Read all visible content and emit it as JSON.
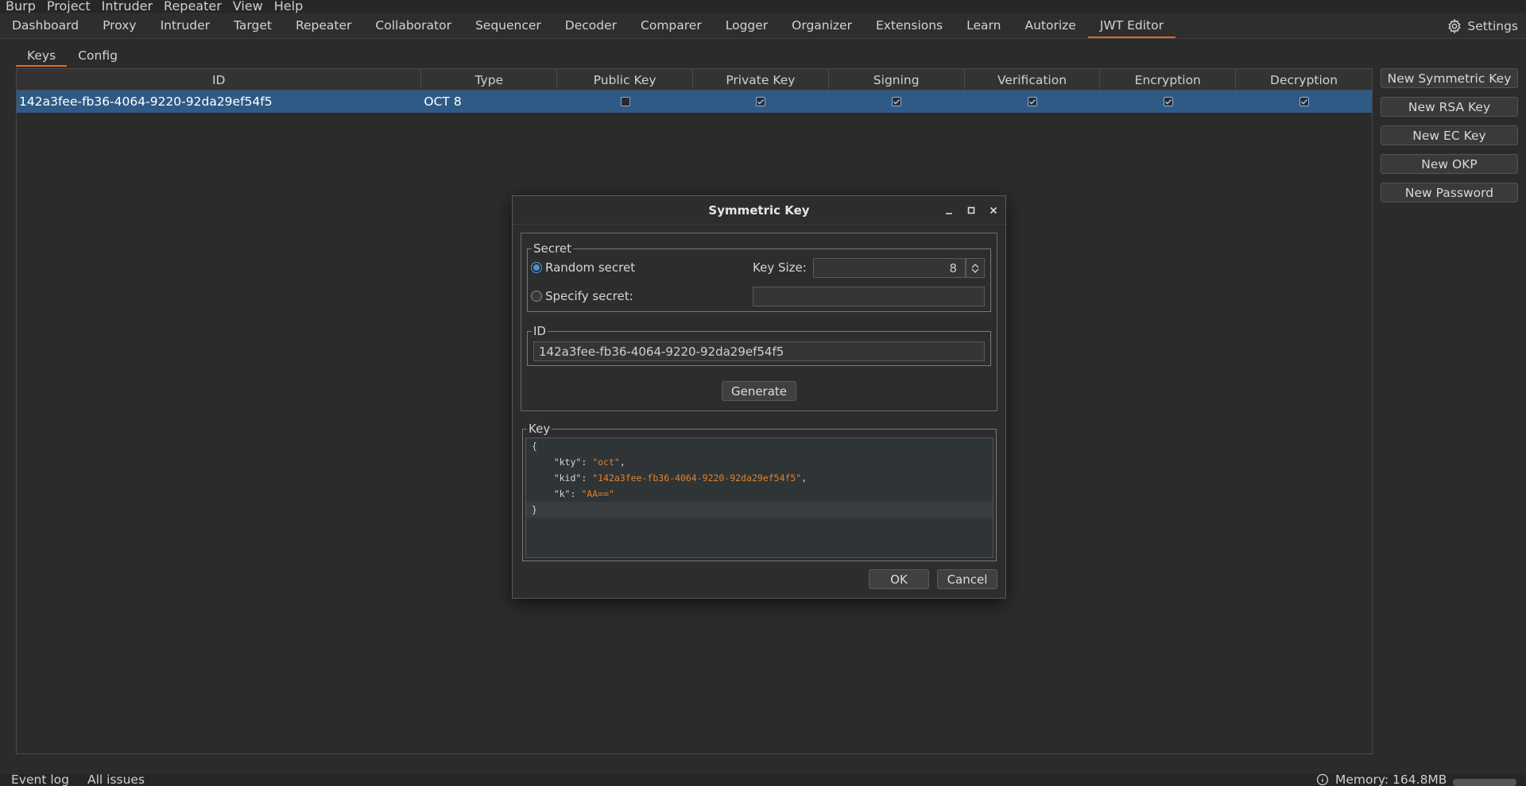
{
  "menubar": [
    "Burp",
    "Project",
    "Intruder",
    "Repeater",
    "View",
    "Help"
  ],
  "tabs": [
    "Dashboard",
    "Proxy",
    "Intruder",
    "Target",
    "Repeater",
    "Collaborator",
    "Sequencer",
    "Decoder",
    "Comparer",
    "Logger",
    "Organizer",
    "Extensions",
    "Learn",
    "Autorize",
    "JWT Editor"
  ],
  "active_tab": "JWT Editor",
  "settings_label": "Settings",
  "subtabs": [
    "Keys",
    "Config"
  ],
  "table": {
    "columns": [
      "ID",
      "Type",
      "Public Key",
      "Private Key",
      "Signing",
      "Verification",
      "Encryption",
      "Decryption"
    ],
    "rows": [
      {
        "id": "142a3fee-fb36-4064-9220-92da29ef54f5",
        "type": "OCT 8",
        "public_key": false,
        "private_key": true,
        "signing": true,
        "verification": true,
        "encryption": true,
        "decryption": true
      }
    ]
  },
  "side_buttons": [
    "New Symmetric Key",
    "New RSA Key",
    "New EC Key",
    "New OKP",
    "New Password"
  ],
  "dialog": {
    "title": "Symmetric Key",
    "secret_legend": "Secret",
    "random_secret_label": "Random secret",
    "specify_secret_label": "Specify secret:",
    "random_selected": true,
    "key_size_label": "Key Size:",
    "key_size_value": "8",
    "specify_secret_value": "",
    "id_legend": "ID",
    "id_value": "142a3fee-fb36-4064-9220-92da29ef54f5",
    "generate_label": "Generate",
    "key_legend": "Key",
    "key_json": {
      "open": "{",
      "kty_key": "\"kty\"",
      "kty_val": "\"oct\"",
      "kid_key": "\"kid\"",
      "kid_val": "\"142a3fee-fb36-4064-9220-92da29ef54f5\"",
      "k_key": "\"k\"",
      "k_val": "\"AA==\"",
      "close": "}"
    },
    "ok_label": "OK",
    "cancel_label": "Cancel"
  },
  "statusbar": {
    "event_log": "Event log",
    "all_issues": "All issues",
    "memory": "Memory: 164.8MB"
  },
  "colors": {
    "accent": "#e4691e",
    "selection": "#2f5a86",
    "string": "#e0822e"
  }
}
